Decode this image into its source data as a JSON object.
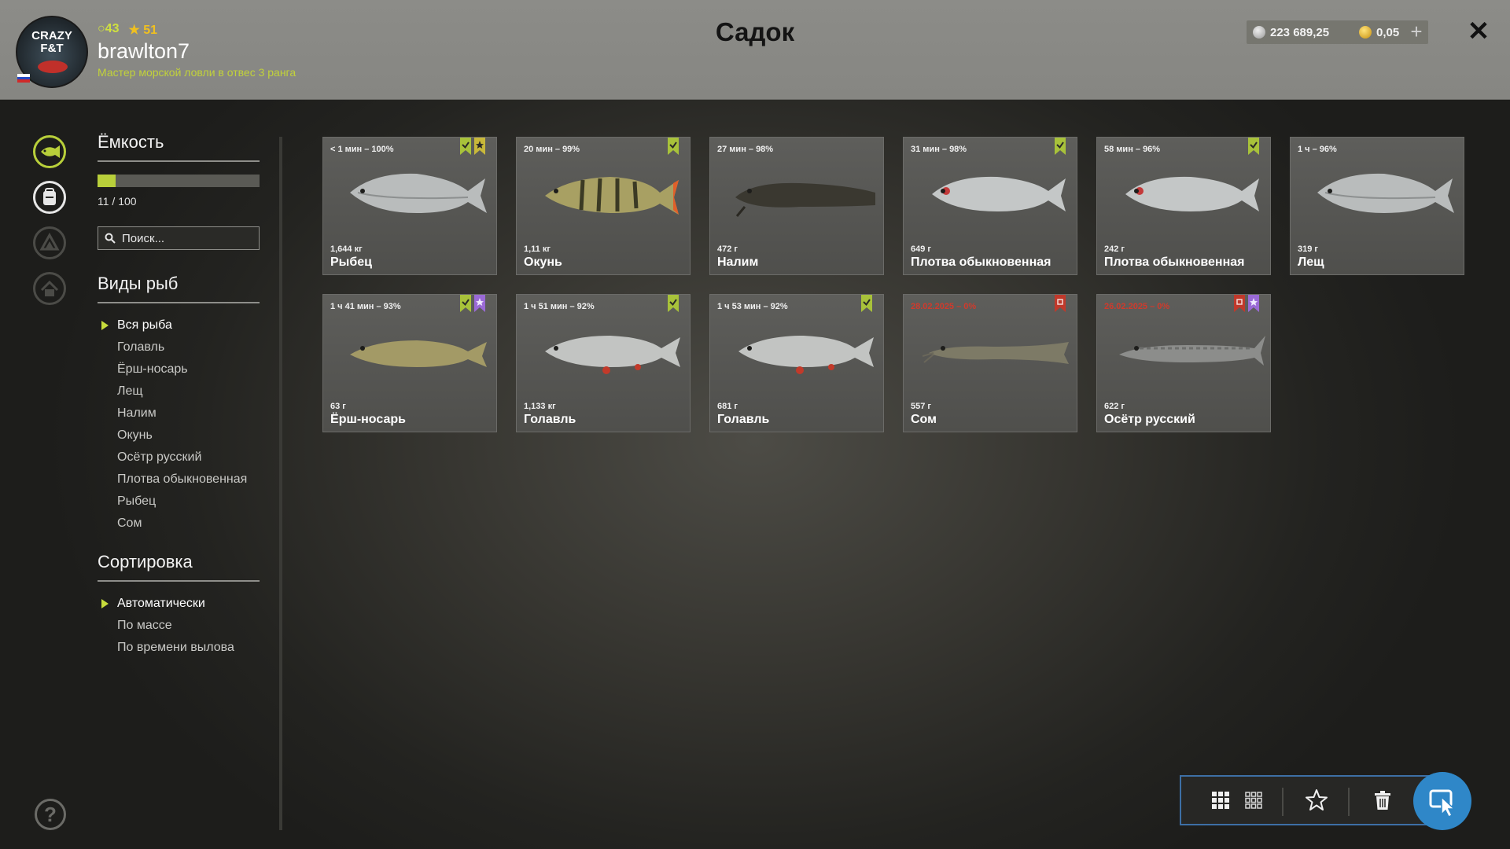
{
  "header": {
    "title": "Садок",
    "username": "brawlton7",
    "user_title": "Мастер морской ловли в отвес 3 ранга",
    "level": "43",
    "rank": "51",
    "avatar_text": [
      "CRAZY",
      "F&T"
    ],
    "silver": "223 689,25",
    "gold": "0,05",
    "plus_label": "+",
    "close_label": "✕"
  },
  "sidebar_icons": [
    "keepnet-fish-icon",
    "backpack-icon",
    "boat-icon",
    "home-icon"
  ],
  "capacity": {
    "title": "Ёмкость",
    "used": 11,
    "total": 100,
    "text": "11 / 100"
  },
  "search": {
    "placeholder": "Поиск..."
  },
  "species": {
    "title": "Виды рыб",
    "items": [
      "Вся рыба",
      "Голавль",
      "Ёрш-носарь",
      "Лещ",
      "Налим",
      "Окунь",
      "Осётр русский",
      "Плотва обыкновенная",
      "Рыбец",
      "Сом"
    ],
    "selected": "Вся рыба"
  },
  "sorting": {
    "title": "Сортировка",
    "items": [
      "Автоматически",
      "По массе",
      "По времени вылова"
    ],
    "selected": "Автоматически"
  },
  "colors": {
    "accent_green": "#b8cf3a",
    "tag_green": "#a8c23a",
    "tag_yellow": "#c8b83a",
    "tag_purple": "#9a6ad6",
    "tag_red": "#c0392b",
    "expired_red": "#d03a2c",
    "toolbar_border": "#3d6fa5",
    "select_blue": "#2f87c8"
  },
  "fish": [
    {
      "caption": "< 1 мин – 100%",
      "weight": "1,644 кг",
      "name": "Рыбец",
      "tags": [
        "green",
        "star"
      ],
      "kind": "bream",
      "expired": false
    },
    {
      "caption": "20 мин – 99%",
      "weight": "1,11 кг",
      "name": "Окунь",
      "tags": [
        "green"
      ],
      "kind": "perch",
      "expired": false
    },
    {
      "caption": "27 мин – 98%",
      "weight": "472 г",
      "name": "Налим",
      "tags": [],
      "kind": "burbot",
      "expired": false
    },
    {
      "caption": "31 мин – 98%",
      "weight": "649 г",
      "name": "Плотва обыкновенная",
      "tags": [
        "green"
      ],
      "kind": "roach",
      "expired": false
    },
    {
      "caption": "58 мин – 96%",
      "weight": "242 г",
      "name": "Плотва обыкновенная",
      "tags": [
        "green"
      ],
      "kind": "roach",
      "expired": false
    },
    {
      "caption": "1 ч – 96%",
      "weight": "319 г",
      "name": "Лещ",
      "tags": [],
      "kind": "bream",
      "expired": false
    },
    {
      "caption": "1 ч 41 мин – 93%",
      "weight": "63 г",
      "name": "Ёрш-носарь",
      "tags": [
        "green",
        "purple"
      ],
      "kind": "ruffe",
      "expired": false
    },
    {
      "caption": "1 ч 51 мин – 92%",
      "weight": "1,133 кг",
      "name": "Голавль",
      "tags": [
        "green"
      ],
      "kind": "chub",
      "expired": false
    },
    {
      "caption": "1 ч 53 мин – 92%",
      "weight": "681 г",
      "name": "Голавль",
      "tags": [
        "green"
      ],
      "kind": "chub",
      "expired": false
    },
    {
      "caption": "28.02.2025 – 0%",
      "weight": "557 г",
      "name": "Сом",
      "tags": [
        "red"
      ],
      "kind": "catfish",
      "expired": true
    },
    {
      "caption": "26.02.2025 – 0%",
      "weight": "622 г",
      "name": "Осётр русский",
      "tags": [
        "red",
        "purple"
      ],
      "kind": "sturgeon",
      "expired": true
    }
  ],
  "toolbar": {
    "buttons": [
      "grid-large-icon",
      "grid-small-icon",
      "favorite-star-icon",
      "trash-icon",
      "select-cursor-icon"
    ]
  },
  "help_label": "?"
}
